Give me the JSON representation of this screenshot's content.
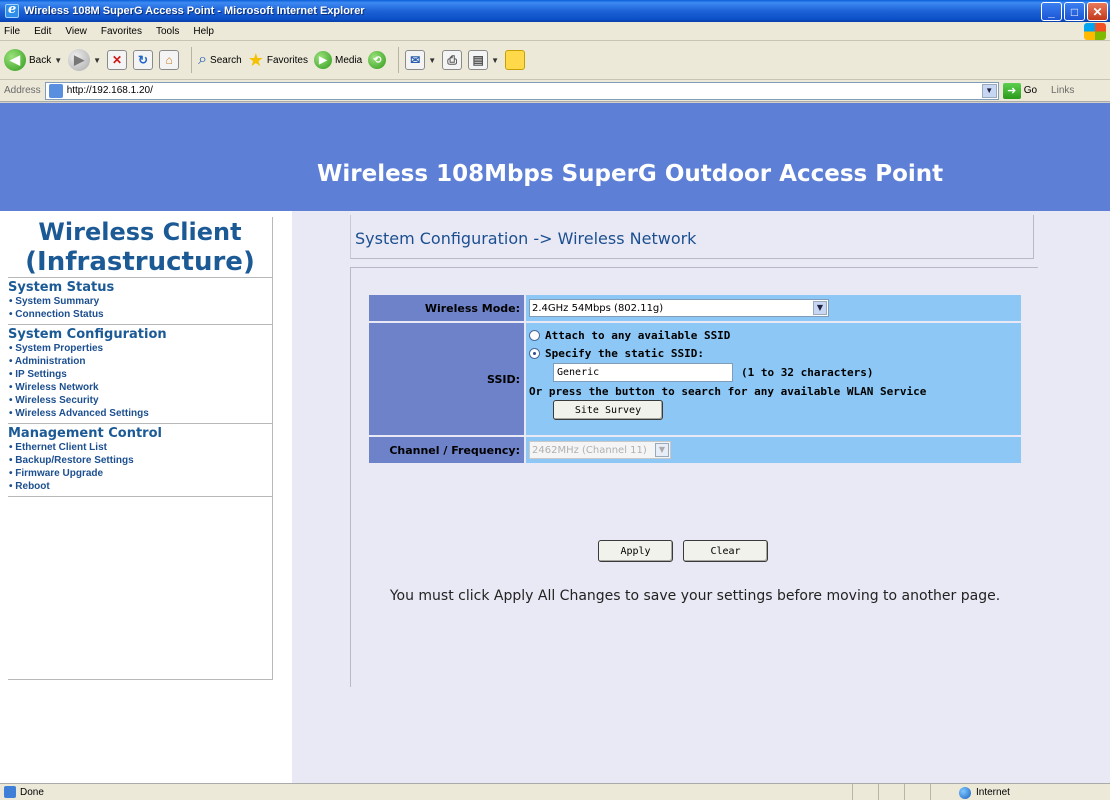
{
  "window": {
    "title": "Wireless 108M SuperG Access Point - Microsoft Internet Explorer",
    "buttons": [
      "_",
      "□",
      "✕"
    ]
  },
  "menubar": [
    "File",
    "Edit",
    "View",
    "Favorites",
    "Tools",
    "Help"
  ],
  "toolbar": {
    "back": "Back",
    "search": "Search",
    "favorites": "Favorites",
    "media": "Media"
  },
  "address": {
    "label": "Address",
    "url": "http://192.168.1.20/",
    "go": "Go",
    "links": "Links"
  },
  "page": {
    "banner_title": "Wireless 108Mbps SuperG Outdoor Access Point",
    "left_title_1": "Wireless Client",
    "left_title_2": "(Infrastructure)",
    "menu": [
      {
        "title": "System Status",
        "items": [
          "System Summary",
          "Connection Status"
        ]
      },
      {
        "title": "System Configuration",
        "items": [
          "System Properties",
          "Administration",
          "IP Settings",
          "Wireless Network",
          "Wireless Security",
          "Wireless Advanced Settings"
        ]
      },
      {
        "title": "Management Control",
        "items": [
          "Ethernet Client List",
          "Backup/Restore Settings",
          "Firmware Upgrade",
          "Reboot"
        ]
      }
    ],
    "breadcrumb": "System Configuration -> Wireless Network",
    "form": {
      "wireless_mode_label": "Wireless Mode:",
      "wireless_mode_value": "2.4GHz 54Mbps (802.11g)",
      "ssid_label": "SSID:",
      "radio_any": "Attach to any available SSID",
      "radio_static": "Specify the static SSID:",
      "ssid_value": "Generic",
      "ssid_hint": "(1 to 32 characters)",
      "survey_hint": "Or press the button to search for any available WLAN Service",
      "site_survey": "Site Survey",
      "channel_label": "Channel / Frequency:",
      "channel_value": "2462MHz (Channel 11)"
    },
    "apply": "Apply",
    "clear": "Clear",
    "notice": "You must click Apply All Changes to save your settings before moving to another page."
  },
  "status": {
    "text": "Done",
    "zone": "Internet"
  }
}
